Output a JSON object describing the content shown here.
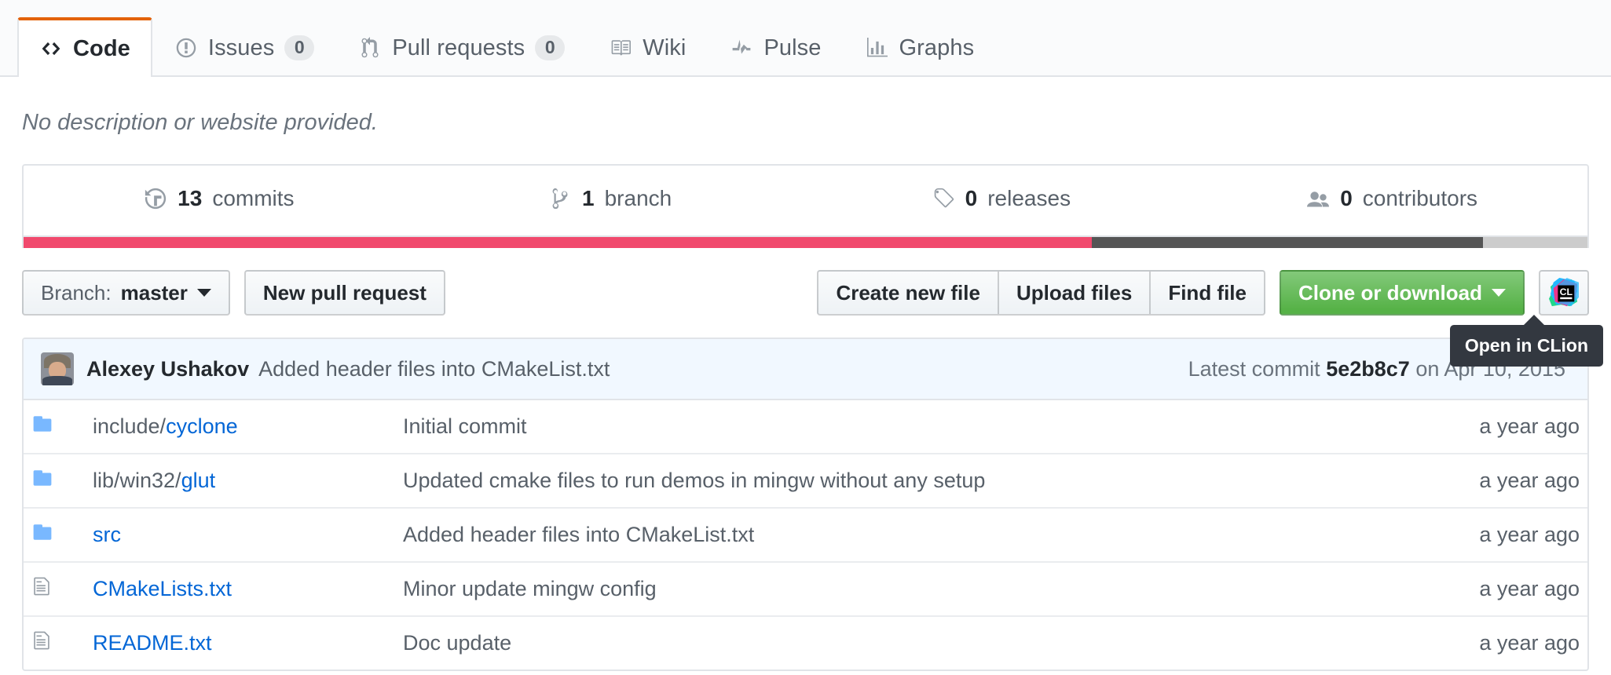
{
  "tabs": [
    {
      "label": "Code",
      "icon": "code-icon",
      "count": null,
      "selected": true
    },
    {
      "label": "Issues",
      "icon": "issue-opened-icon",
      "count": "0",
      "selected": false
    },
    {
      "label": "Pull requests",
      "icon": "git-pull-request-icon",
      "count": "0",
      "selected": false
    },
    {
      "label": "Wiki",
      "icon": "book-icon",
      "count": null,
      "selected": false
    },
    {
      "label": "Pulse",
      "icon": "pulse-icon",
      "count": null,
      "selected": false
    },
    {
      "label": "Graphs",
      "icon": "graph-icon",
      "count": null,
      "selected": false
    }
  ],
  "repo": {
    "description": "No description or website provided."
  },
  "summary": [
    {
      "icon": "history-icon",
      "count": "13",
      "label": "commits"
    },
    {
      "icon": "git-branch-icon",
      "count": "1",
      "label": "branch"
    },
    {
      "icon": "tag-icon",
      "count": "0",
      "label": "releases"
    },
    {
      "icon": "organization-icon",
      "count": "0",
      "label": "contributors"
    }
  ],
  "languages": [
    {
      "name": "pink-language",
      "color": "#f1496d",
      "percent": 68.3
    },
    {
      "name": "gray-language",
      "color": "#555555",
      "percent": 25.0
    },
    {
      "name": "other-language",
      "color": "#cccccc",
      "percent": 6.7
    }
  ],
  "toolbar": {
    "branch_prefix": "Branch:",
    "branch_name": "master",
    "new_pull_request": "New pull request",
    "create_new_file": "Create new file",
    "upload_files": "Upload files",
    "find_file": "Find file",
    "clone_or_download": "Clone or download",
    "ide_icon": "clion-icon",
    "ide_tooltip": "Open in CLion"
  },
  "latest_commit": {
    "author": "Alexey Ushakov",
    "message": "Added header files into CMakeList.txt",
    "meta_prefix": "Latest commit",
    "sha": "5e2b8c7",
    "date_prefix": "on",
    "date": "Apr 10, 2015"
  },
  "files": [
    {
      "type": "directory",
      "icon": "file-directory-icon",
      "path_prefix": "include/",
      "name": "cyclone",
      "message": "Initial commit",
      "age": "a year ago"
    },
    {
      "type": "directory",
      "icon": "file-directory-icon",
      "path_prefix": "lib/win32/",
      "name": "glut",
      "message": "Updated cmake files to run demos in mingw without any setup",
      "age": "a year ago"
    },
    {
      "type": "directory",
      "icon": "file-directory-icon",
      "path_prefix": "",
      "name": "src",
      "message": "Added header files into CMakeList.txt",
      "age": "a year ago"
    },
    {
      "type": "file",
      "icon": "file-text-icon",
      "path_prefix": "",
      "name": "CMakeLists.txt",
      "message": "Minor update mingw config",
      "age": "a year ago"
    },
    {
      "type": "file",
      "icon": "file-text-icon",
      "path_prefix": "",
      "name": "README.txt",
      "message": "Doc update",
      "age": "a year ago"
    }
  ],
  "colors": {
    "tab_active_top": "#e36209",
    "link": "#0366d6",
    "primary_button": "#60b44f",
    "commit_bar_bg": "#f1f8ff"
  }
}
